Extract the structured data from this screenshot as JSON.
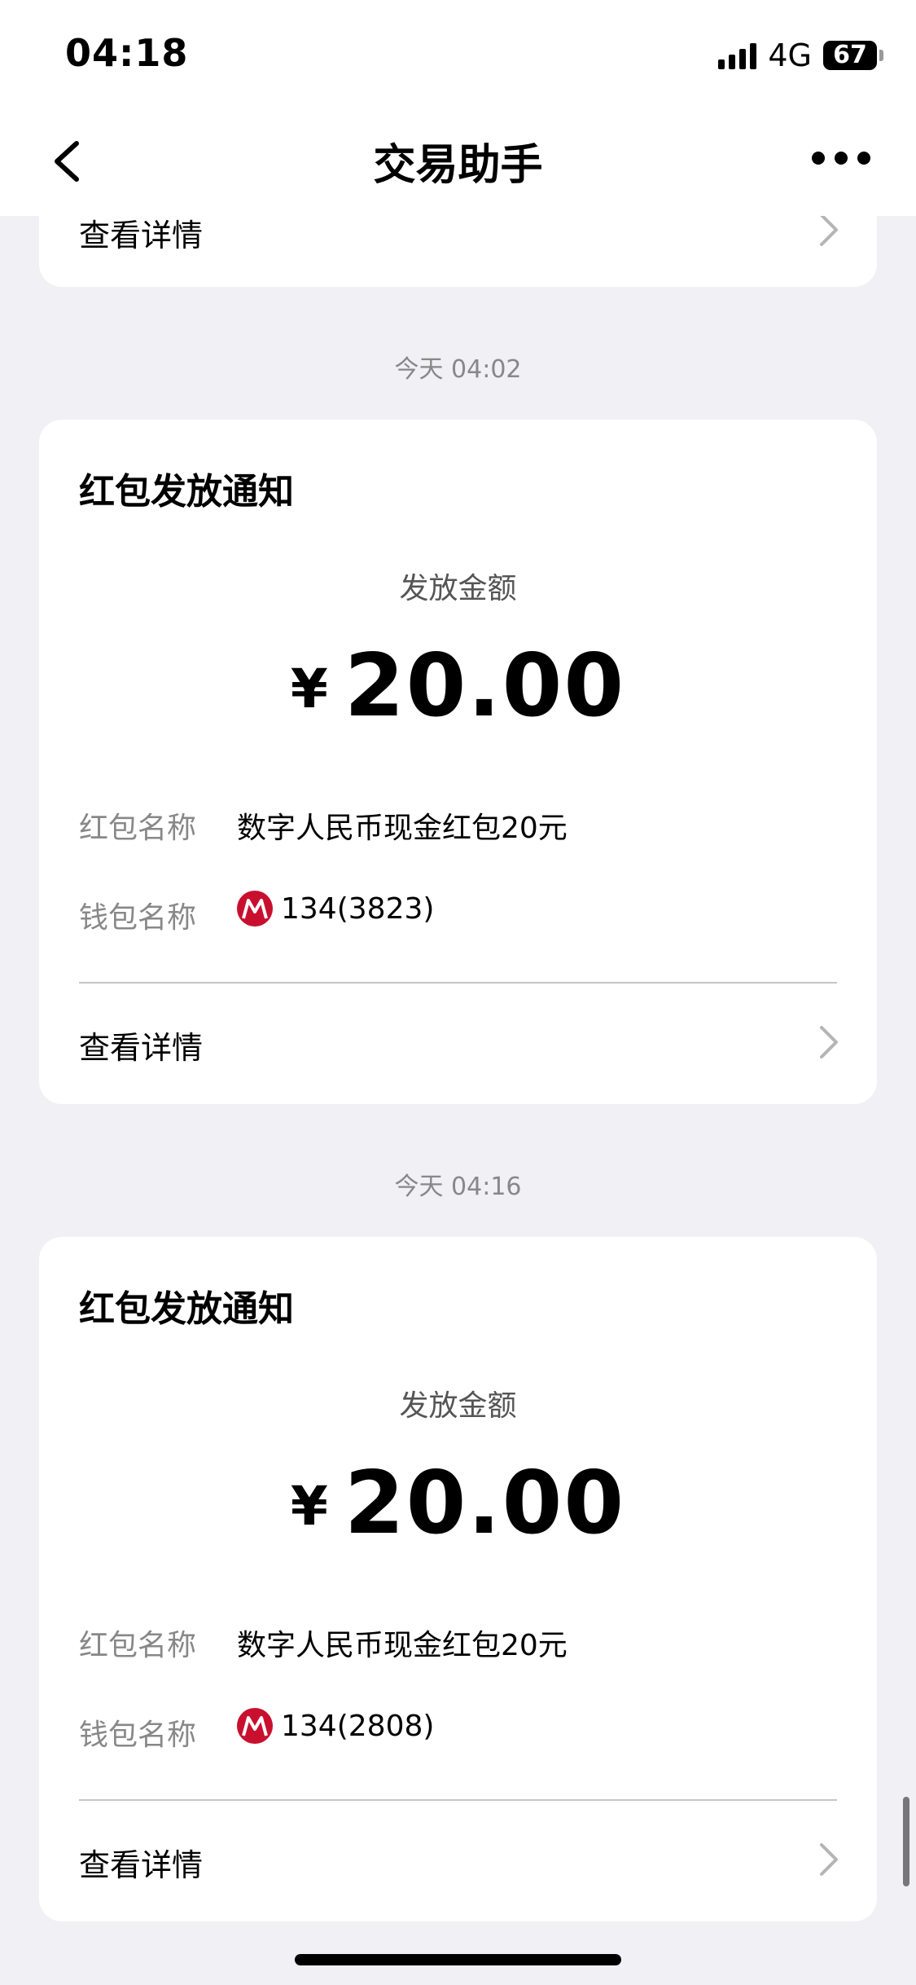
{
  "status_bar": {
    "time": "04:18",
    "network": "4G",
    "battery": "67"
  },
  "nav": {
    "title": "交易助手"
  },
  "partial_card": {
    "detail_label": "查看详情"
  },
  "messages": [
    {
      "timestamp": "今天 04:02",
      "title": "红包发放通知",
      "amount_label": "发放金额",
      "currency": "¥",
      "amount": "20.00",
      "rows": [
        {
          "label": "红包名称",
          "value": "数字人民币现金红包20元"
        },
        {
          "label": "钱包名称",
          "value": "134(3823)",
          "icon": "bank-logo-icon"
        }
      ],
      "detail_label": "查看详情"
    },
    {
      "timestamp": "今天 04:16",
      "title": "红包发放通知",
      "amount_label": "发放金额",
      "currency": "¥",
      "amount": "20.00",
      "rows": [
        {
          "label": "红包名称",
          "value": "数字人民币现金红包20元"
        },
        {
          "label": "钱包名称",
          "value": "134(2808)",
          "icon": "bank-logo-icon"
        }
      ],
      "detail_label": "查看详情"
    }
  ],
  "colors": {
    "background": "#f0f0f5",
    "card": "#ffffff",
    "muted_text": "#888888",
    "bank_logo": "#c8102e"
  }
}
